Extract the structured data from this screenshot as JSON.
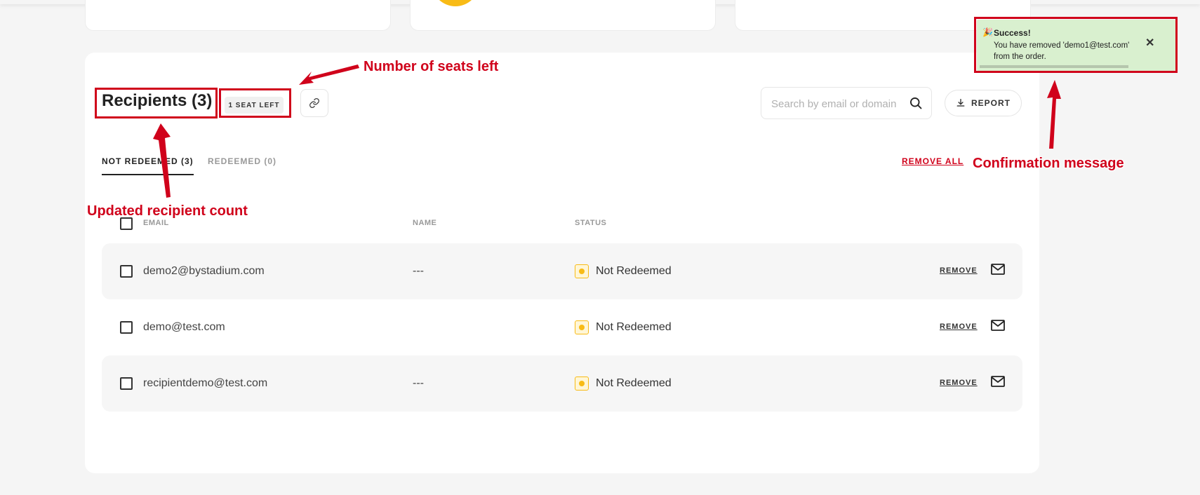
{
  "header": {
    "title": "Recipients (3)",
    "seat_badge": "1 SEAT LEFT"
  },
  "search": {
    "placeholder": "Search by email or domain"
  },
  "toolbar": {
    "report_label": "REPORT"
  },
  "tabs": [
    {
      "label": "NOT REDEEMED (3)",
      "active": true
    },
    {
      "label": "REDEEMED (0)",
      "active": false
    }
  ],
  "actions": {
    "remove_all_label": "REMOVE ALL"
  },
  "table": {
    "columns": [
      "EMAIL",
      "NAME",
      "STATUS"
    ],
    "rows": [
      {
        "email": "demo2@bystadium.com",
        "name": "---",
        "status": "Not Redeemed",
        "action": "REMOVE"
      },
      {
        "email": "demo@test.com",
        "name": "",
        "status": "Not Redeemed",
        "action": "REMOVE"
      },
      {
        "email": "recipientdemo@test.com",
        "name": "---",
        "status": "Not Redeemed",
        "action": "REMOVE"
      }
    ]
  },
  "toast": {
    "title": "Success!",
    "message": "You have removed 'demo1@test.com' from the order.",
    "close": "✕",
    "icon": "🎉"
  },
  "annotations": {
    "seats": "Number of seats left",
    "count": "Updated recipient count",
    "confirmation": "Confirmation message"
  },
  "colors": {
    "accent": "#d0021b",
    "status_pending": "#f8bb16",
    "toast_bg": "#d9f0cf"
  }
}
